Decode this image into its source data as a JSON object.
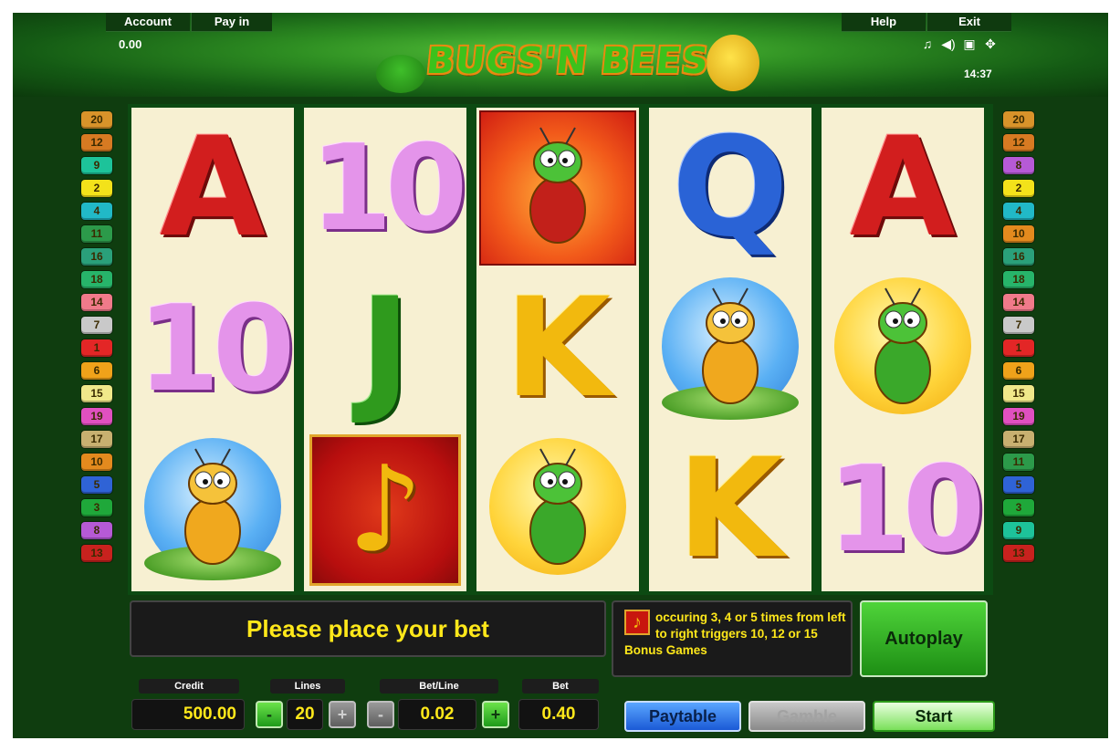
{
  "header": {
    "account_label": "Account",
    "payin_label": "Pay in",
    "help_label": "Help",
    "exit_label": "Exit",
    "account_value": "0.00",
    "time": "14:37",
    "logo_text": "BUGS'N BEES",
    "icons": [
      "music-icon",
      "speaker-icon",
      "screen-icon",
      "fullscreen-icon"
    ]
  },
  "paylines": {
    "left": [
      "20",
      "12",
      "9",
      "2",
      "4",
      "11",
      "16",
      "18",
      "14",
      "7",
      "1",
      "6",
      "15",
      "19",
      "17",
      "10",
      "5",
      "3",
      "8",
      "13"
    ],
    "right": [
      "20",
      "12",
      "8",
      "2",
      "4",
      "10",
      "16",
      "18",
      "14",
      "7",
      "1",
      "6",
      "15",
      "19",
      "17",
      "11",
      "5",
      "3",
      "9",
      "13"
    ],
    "colors": {
      "1": "#e32626",
      "2": "#f3e21a",
      "3": "#1fa83a",
      "4": "#21b9c7",
      "5": "#2f63d6",
      "6": "#f0a21a",
      "7": "#c9c9c9",
      "8": "#b65ad6",
      "9": "#1dc39a",
      "10": "#e38a1e",
      "11": "#2c9a4a",
      "12": "#d77a22",
      "13": "#c8221e",
      "14": "#f07a8a",
      "15": "#f0e88a",
      "16": "#2aa07a",
      "17": "#c8b070",
      "18": "#27b46a",
      "19": "#e050c0",
      "20": "#d8932a"
    }
  },
  "reels": [
    [
      "A",
      "10",
      "bug"
    ],
    [
      "10",
      "J",
      "note"
    ],
    [
      "ladybird",
      "K",
      "caterpillar"
    ],
    [
      "Q",
      "bug",
      "K"
    ],
    [
      "A",
      "caterpillar",
      "10"
    ]
  ],
  "controls": {
    "message": "Please place your bet",
    "info_text": "occuring 3, 4 or 5 times from left to right triggers 10, 12 or 15 Bonus Games",
    "autoplay_label": "Autoplay",
    "credit_label": "Credit",
    "credit_value": "500.00",
    "lines_label": "Lines",
    "lines_value": "20",
    "betline_label": "Bet/Line",
    "betline_value": "0.02",
    "bet_label": "Bet",
    "bet_value": "0.40",
    "minus": "-",
    "plus": "+",
    "paytable_label": "Paytable",
    "gamble_label": "Gamble",
    "start_label": "Start"
  }
}
